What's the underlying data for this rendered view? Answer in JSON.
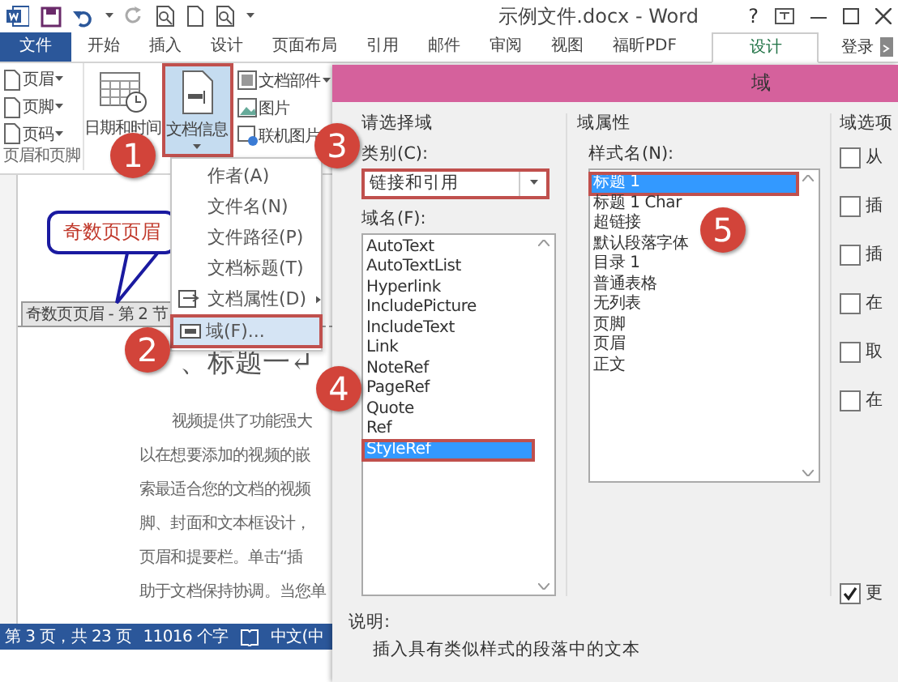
{
  "window": {
    "title": "示例文件.docx - Word",
    "help": "?"
  },
  "ribbon_tabs": [
    {
      "label": "文件",
      "kind": "file",
      "selected": false
    },
    {
      "label": "开始",
      "kind": "tab",
      "selected": false
    },
    {
      "label": "插入",
      "kind": "tab",
      "selected": false
    },
    {
      "label": "设计",
      "kind": "tab",
      "selected": false
    },
    {
      "label": "页面布局",
      "kind": "tab",
      "selected": false
    },
    {
      "label": "引用",
      "kind": "tab",
      "selected": false
    },
    {
      "label": "邮件",
      "kind": "tab",
      "selected": false
    },
    {
      "label": "审阅",
      "kind": "tab",
      "selected": false
    },
    {
      "label": "视图",
      "kind": "tab",
      "selected": false
    },
    {
      "label": "福昕PDF",
      "kind": "tab",
      "selected": false
    },
    {
      "label": "设计",
      "kind": "contextual",
      "selected": true
    }
  ],
  "account": "登录",
  "ribbon": {
    "header_footer": {
      "buttons": [
        {
          "label": "页眉"
        },
        {
          "label": "页脚"
        },
        {
          "label": "页码"
        }
      ],
      "group_label": "页眉和页脚"
    },
    "date_time": "日期和时间",
    "doc_info": {
      "label": "文档信息",
      "selected": true
    },
    "insert_buttons": [
      {
        "label": "文档部件",
        "dropdown": true
      },
      {
        "label": "图片",
        "dropdown": false
      },
      {
        "label": "联机图片",
        "dropdown": false
      }
    ]
  },
  "doc_info_menu": [
    {
      "label": "作者(A)",
      "kind": "plain",
      "selected": false
    },
    {
      "label": "文件名(N)",
      "kind": "plain",
      "selected": false
    },
    {
      "label": "文件路径(P)",
      "kind": "plain",
      "selected": false
    },
    {
      "label": "文档标题(T)",
      "kind": "plain",
      "selected": false
    },
    {
      "label": "文档属性(D)",
      "kind": "submenu",
      "selected": false
    },
    {
      "label": "域(F)...",
      "kind": "field",
      "selected": true
    }
  ],
  "document": {
    "callout": "奇数页页眉",
    "header_tag": "奇数页页眉 - 第 2 节",
    "heading": "、标题一↵",
    "lines": [
      "视频提供了功能强大",
      "以在想要添加的视频的嵌",
      "索最适合您的文档的视频",
      "脚、封面和文本框设计，",
      "页眉和提要栏。单击“插",
      "助于文档保持协调。当您单"
    ]
  },
  "status_bar": {
    "page": "第 3 页，共 23 页",
    "words": "11016 个字",
    "language": "中文(中"
  },
  "dialog": {
    "title": "域",
    "choose": {
      "heading": "请选择域",
      "category_label": "类别(C):",
      "category": {
        "value": "链接和引用",
        "highlighted": true
      },
      "names_label": "域名(F):",
      "names": [
        {
          "label": "AutoText",
          "selected": false
        },
        {
          "label": "AutoTextList",
          "selected": false
        },
        {
          "label": "Hyperlink",
          "selected": false
        },
        {
          "label": "IncludePicture",
          "selected": false
        },
        {
          "label": "IncludeText",
          "selected": false
        },
        {
          "label": "Link",
          "selected": false
        },
        {
          "label": "NoteRef",
          "selected": false
        },
        {
          "label": "PageRef",
          "selected": false
        },
        {
          "label": "Quote",
          "selected": false
        },
        {
          "label": "Ref",
          "selected": false
        },
        {
          "label": "StyleRef",
          "selected": true
        }
      ]
    },
    "properties": {
      "heading": "域属性",
      "style_label": "样式名(N):",
      "styles": [
        {
          "label": "标题 1",
          "selected": true
        },
        {
          "label": "标题 1 Char",
          "selected": false
        },
        {
          "label": "超链接",
          "selected": false
        },
        {
          "label": "默认段落字体",
          "selected": false
        },
        {
          "label": "目录 1",
          "selected": false
        },
        {
          "label": "普通表格",
          "selected": false
        },
        {
          "label": "无列表",
          "selected": false
        },
        {
          "label": "页脚",
          "selected": false
        },
        {
          "label": "页眉",
          "selected": false
        },
        {
          "label": "正文",
          "selected": false
        }
      ]
    },
    "options": {
      "heading": "域选项",
      "checkboxes": [
        {
          "label": "从",
          "checked": false
        },
        {
          "label": "插",
          "checked": false
        },
        {
          "label": "插",
          "checked": false
        },
        {
          "label": "在",
          "checked": false
        },
        {
          "label": "取",
          "checked": false
        },
        {
          "label": "在",
          "checked": false
        }
      ],
      "bottom_checkbox": {
        "label": "更",
        "checked": true
      }
    },
    "description_label": "说明:",
    "description": "插入具有类似样式的段落中的文本"
  },
  "step_markers": [
    "1",
    "2",
    "3",
    "4",
    "5"
  ]
}
